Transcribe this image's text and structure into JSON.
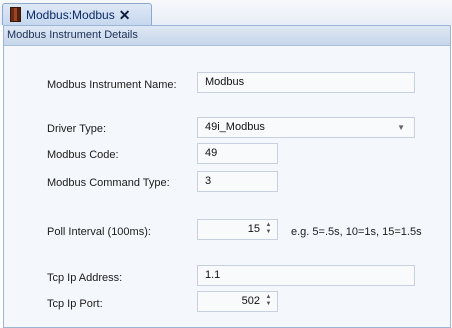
{
  "tab": {
    "title": "Modbus:Modbus",
    "close_glyph": "✕"
  },
  "panel": {
    "header": "Modbus Instrument Details"
  },
  "fields": {
    "instrument_name": {
      "label": "Modbus Instrument Name:",
      "value": "Modbus"
    },
    "driver_type": {
      "label": "Driver Type:",
      "value": "49i_Modbus"
    },
    "modbus_code": {
      "label": "Modbus Code:",
      "value": "49"
    },
    "command_type": {
      "label": "Modbus Command Type:",
      "value": "3"
    },
    "poll_interval": {
      "label": "Poll Interval (100ms):",
      "value": "15",
      "hint": "e.g. 5=.5s, 10=1s, 15=1.5s"
    },
    "tcp_ip_address": {
      "label": "Tcp Ip Address:",
      "value": "1.1"
    },
    "tcp_ip_port": {
      "label": "Tcp Ip Port:",
      "value": "502"
    }
  }
}
